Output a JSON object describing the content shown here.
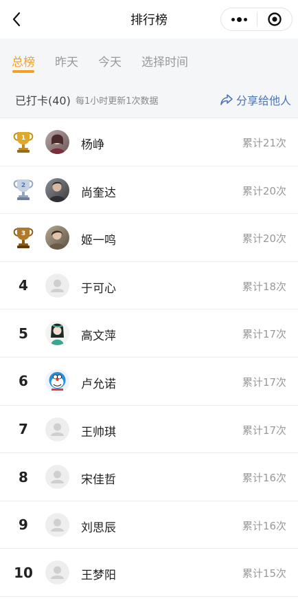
{
  "nav": {
    "title": "排行榜"
  },
  "tabs": [
    {
      "label": "总榜",
      "active": true
    },
    {
      "label": "昨天",
      "active": false
    },
    {
      "label": "今天",
      "active": false
    },
    {
      "label": "选择时间",
      "active": false
    }
  ],
  "info": {
    "count_label": "已打卡(40)",
    "note": "每1小时更新1次数据",
    "share_label": "分享给他人"
  },
  "colors": {
    "accent": "#f5a020",
    "link": "#4a73b8",
    "gold": "#d9a12a",
    "silver": "#b8c6d8",
    "bronze": "#a8752a"
  },
  "ranking": [
    {
      "rank": "1",
      "trophy": "gold-trophy-icon",
      "avatar": "photo-avatar",
      "name": "杨峥",
      "total": "累计21次"
    },
    {
      "rank": "2",
      "trophy": "silver-trophy-icon",
      "avatar": "photo-avatar",
      "name": "尚奎达",
      "total": "累计20次"
    },
    {
      "rank": "3",
      "trophy": "bronze-trophy-icon",
      "avatar": "photo-avatar",
      "name": "姬一鸣",
      "total": "累计20次"
    },
    {
      "rank": "4",
      "avatar": "default-avatar",
      "name": "于可心",
      "total": "累计18次"
    },
    {
      "rank": "5",
      "avatar": "illustrated-avatar",
      "name": "高文萍",
      "total": "累计17次"
    },
    {
      "rank": "6",
      "avatar": "cartoon-cat-avatar",
      "name": "卢允诺",
      "total": "累计17次"
    },
    {
      "rank": "7",
      "avatar": "default-avatar",
      "name": "王帅琪",
      "total": "累计17次"
    },
    {
      "rank": "8",
      "avatar": "default-avatar",
      "name": "宋佳哲",
      "total": "累计16次"
    },
    {
      "rank": "9",
      "avatar": "default-avatar",
      "name": "刘思辰",
      "total": "累计16次"
    },
    {
      "rank": "10",
      "avatar": "default-avatar",
      "name": "王梦阳",
      "total": "累计15次"
    }
  ]
}
